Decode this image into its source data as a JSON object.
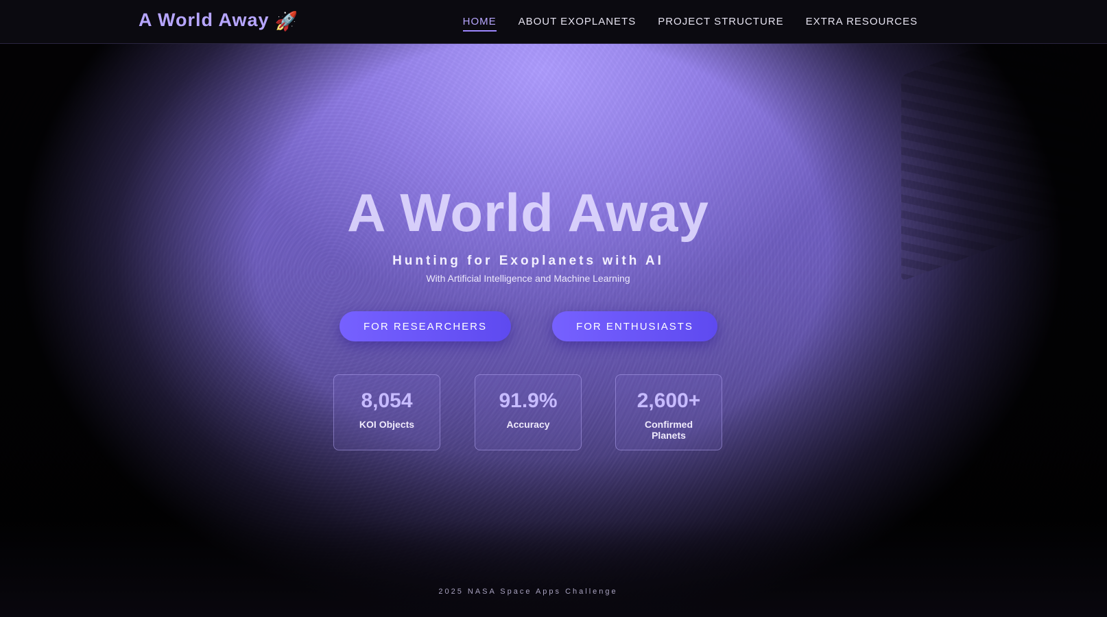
{
  "header": {
    "brand": "A World Away",
    "brand_icon": "🚀",
    "nav": [
      {
        "label": "HOME",
        "active": true
      },
      {
        "label": "ABOUT EXOPLANETS",
        "active": false
      },
      {
        "label": "PROJECT STRUCTURE",
        "active": false
      },
      {
        "label": "EXTRA RESOURCES",
        "active": false
      }
    ]
  },
  "hero": {
    "title": "A World Away",
    "subtitle": "Hunting for Exoplanets with AI",
    "tagline": "With Artificial Intelligence and Machine Learning",
    "buttons": {
      "researchers": "FOR RESEARCHERS",
      "enthusiasts": "FOR ENTHUSIASTS"
    },
    "stats": [
      {
        "value": "8,054",
        "label": "KOI Objects"
      },
      {
        "value": "91.9%",
        "label": "Accuracy"
      },
      {
        "value": "2,600+",
        "label": "Confirmed Planets"
      }
    ]
  },
  "footer": {
    "text": "2025 NASA Space Apps Challenge"
  },
  "colors": {
    "accent": "#b7a6ff",
    "button": "#6a55f8",
    "nav_background": "#0b0a10"
  }
}
